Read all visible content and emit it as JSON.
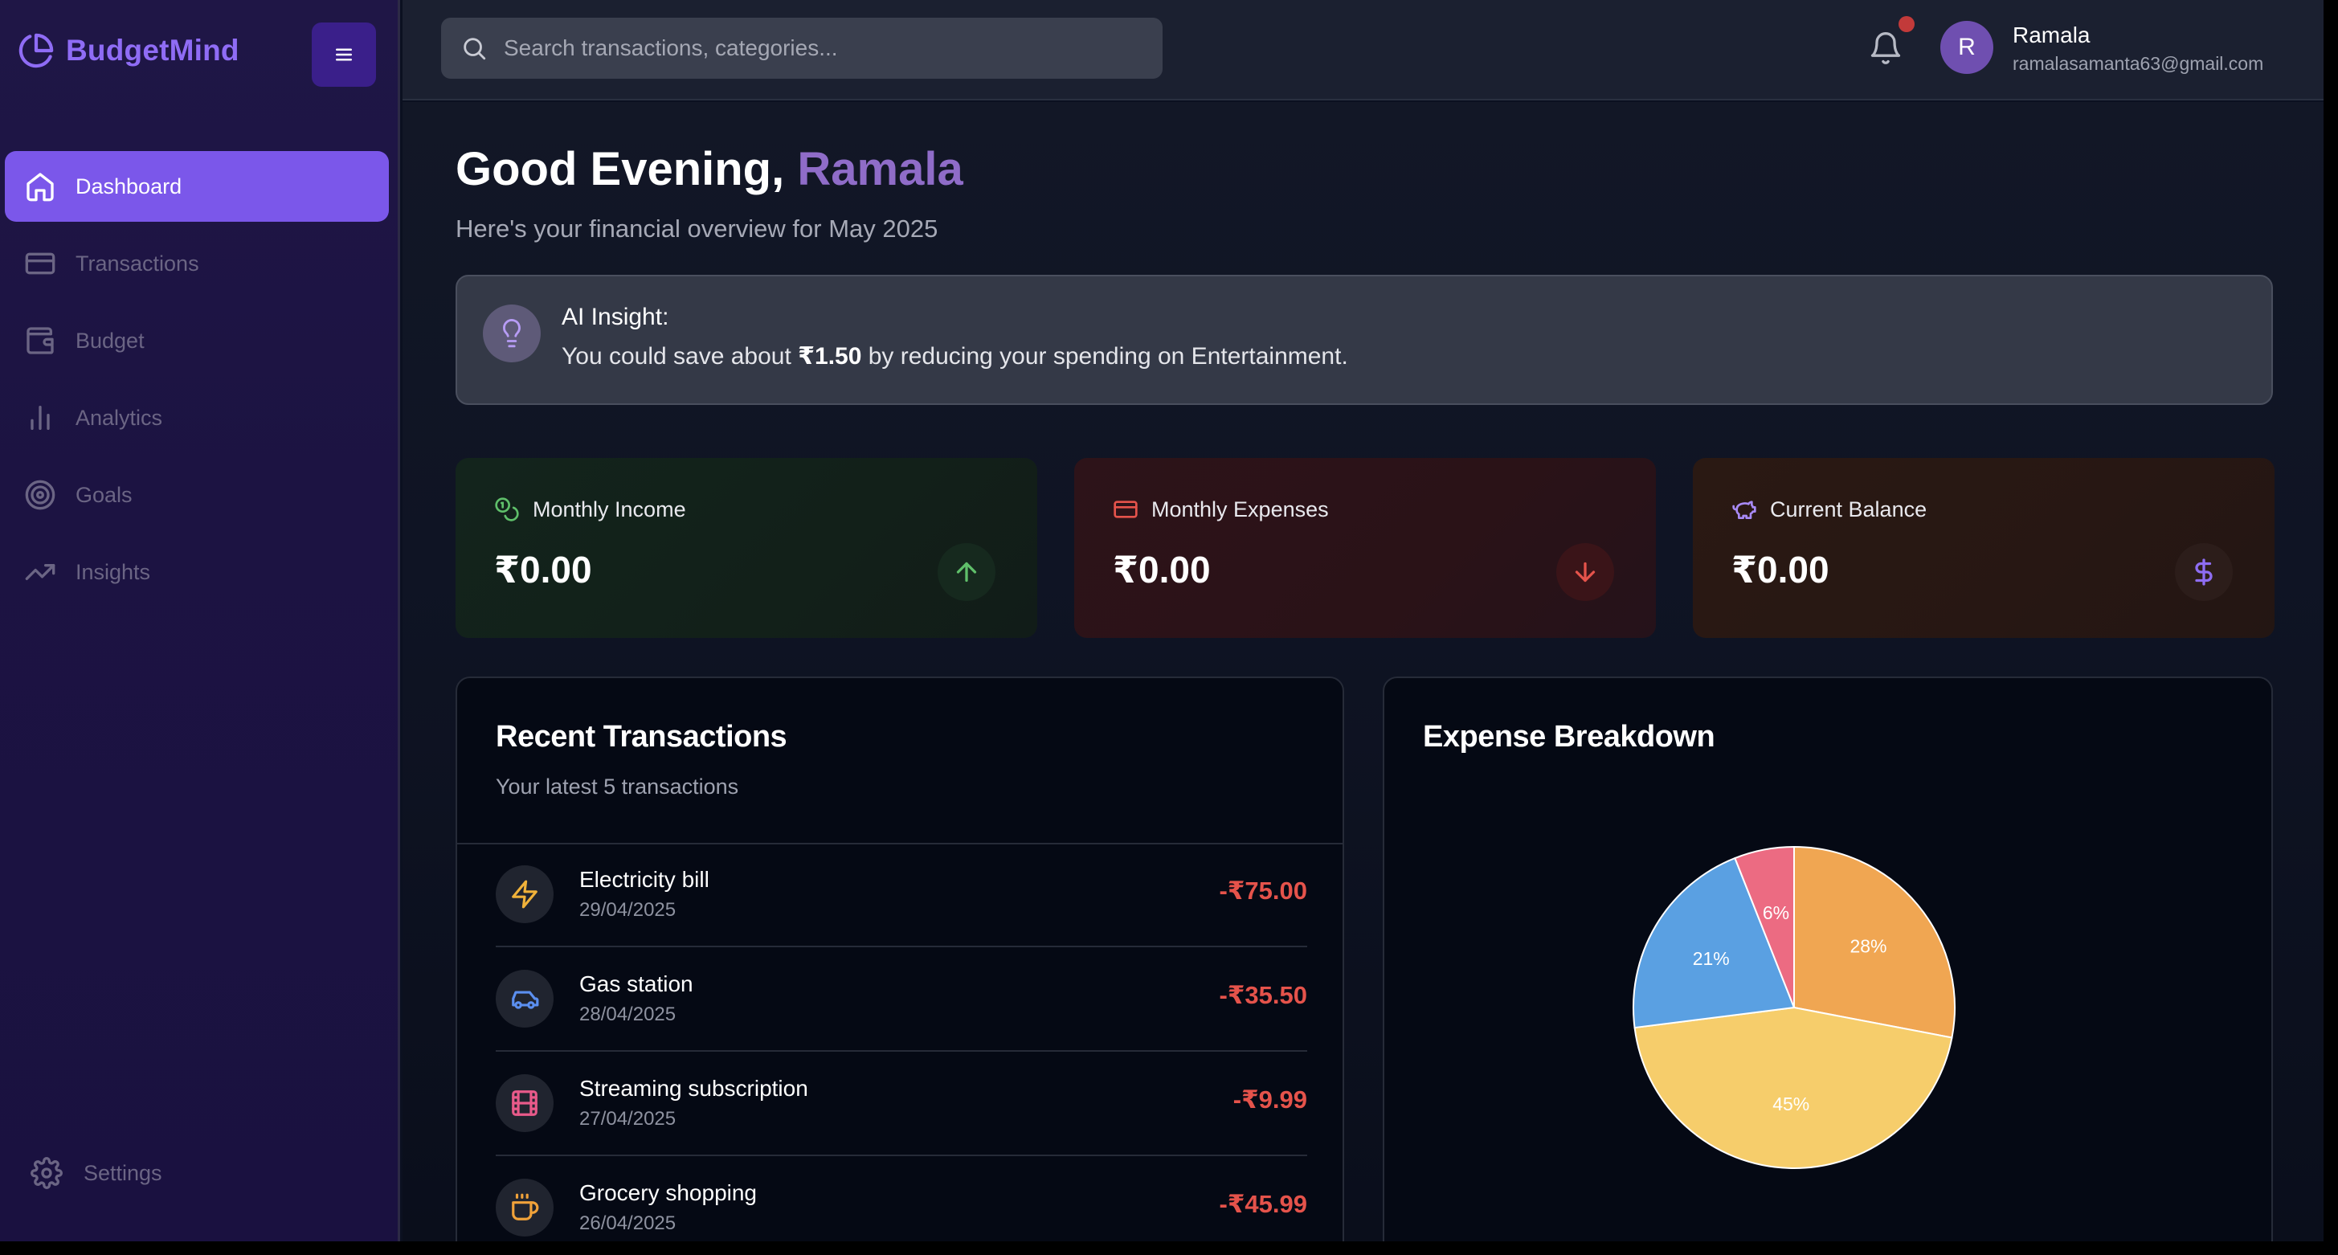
{
  "brand": {
    "name": "BudgetMind",
    "logo_icon": "pie-logo-icon"
  },
  "sidebar": {
    "items": [
      {
        "label": "Dashboard",
        "icon": "home-icon",
        "active": true
      },
      {
        "label": "Transactions",
        "icon": "card-icon",
        "active": false
      },
      {
        "label": "Budget",
        "icon": "wallet-icon",
        "active": false
      },
      {
        "label": "Analytics",
        "icon": "bar-chart-icon",
        "active": false
      },
      {
        "label": "Goals",
        "icon": "target-icon",
        "active": false
      },
      {
        "label": "Insights",
        "icon": "trending-up-icon",
        "active": false
      }
    ],
    "settings_label": "Settings"
  },
  "topbar": {
    "search_placeholder": "Search transactions, categories...",
    "user": {
      "initial": "R",
      "name": "Ramala",
      "email": "ramalasamanta63@gmail.com"
    }
  },
  "header": {
    "greeting": "Good Evening,",
    "name": "Ramala",
    "subtitle": "Here's your financial overview for May 2025"
  },
  "insight": {
    "title": "AI Insight:",
    "text_before": "You could save about ",
    "amount": "₹1.50",
    "text_after": " by reducing your spending on Entertainment."
  },
  "stats": {
    "income": {
      "label": "Monthly Income",
      "value": "₹0.00"
    },
    "expenses": {
      "label": "Monthly Expenses",
      "value": "₹0.00"
    },
    "balance": {
      "label": "Current Balance",
      "value": "₹0.00"
    }
  },
  "transactions": {
    "title": "Recent Transactions",
    "subtitle": "Your latest 5 transactions",
    "items": [
      {
        "name": "Electricity bill",
        "date": "29/04/2025",
        "amount": "-₹75.00",
        "icon": "lightning-icon"
      },
      {
        "name": "Gas station",
        "date": "28/04/2025",
        "amount": "-₹35.50",
        "icon": "car-icon"
      },
      {
        "name": "Streaming subscription",
        "date": "27/04/2025",
        "amount": "-₹9.99",
        "icon": "film-icon"
      },
      {
        "name": "Grocery shopping",
        "date": "26/04/2025",
        "amount": "-₹45.99",
        "icon": "coffee-icon"
      }
    ]
  },
  "breakdown": {
    "title": "Expense Breakdown"
  },
  "chart_data": {
    "type": "pie",
    "slices": [
      {
        "value": 28,
        "label": "28%",
        "color": "#f0a652"
      },
      {
        "value": 45,
        "label": "45%",
        "color": "#f6cd6b"
      },
      {
        "value": 21,
        "label": "21%",
        "color": "#5aa0e2"
      },
      {
        "value": 6,
        "label": "6%",
        "color": "#ec6b82"
      }
    ]
  },
  "colors": {
    "accent": "#7b57ea",
    "negative": "#e5534b",
    "income_arrow": "#5fbf6a",
    "balance_dollar": "#8e6df2"
  }
}
